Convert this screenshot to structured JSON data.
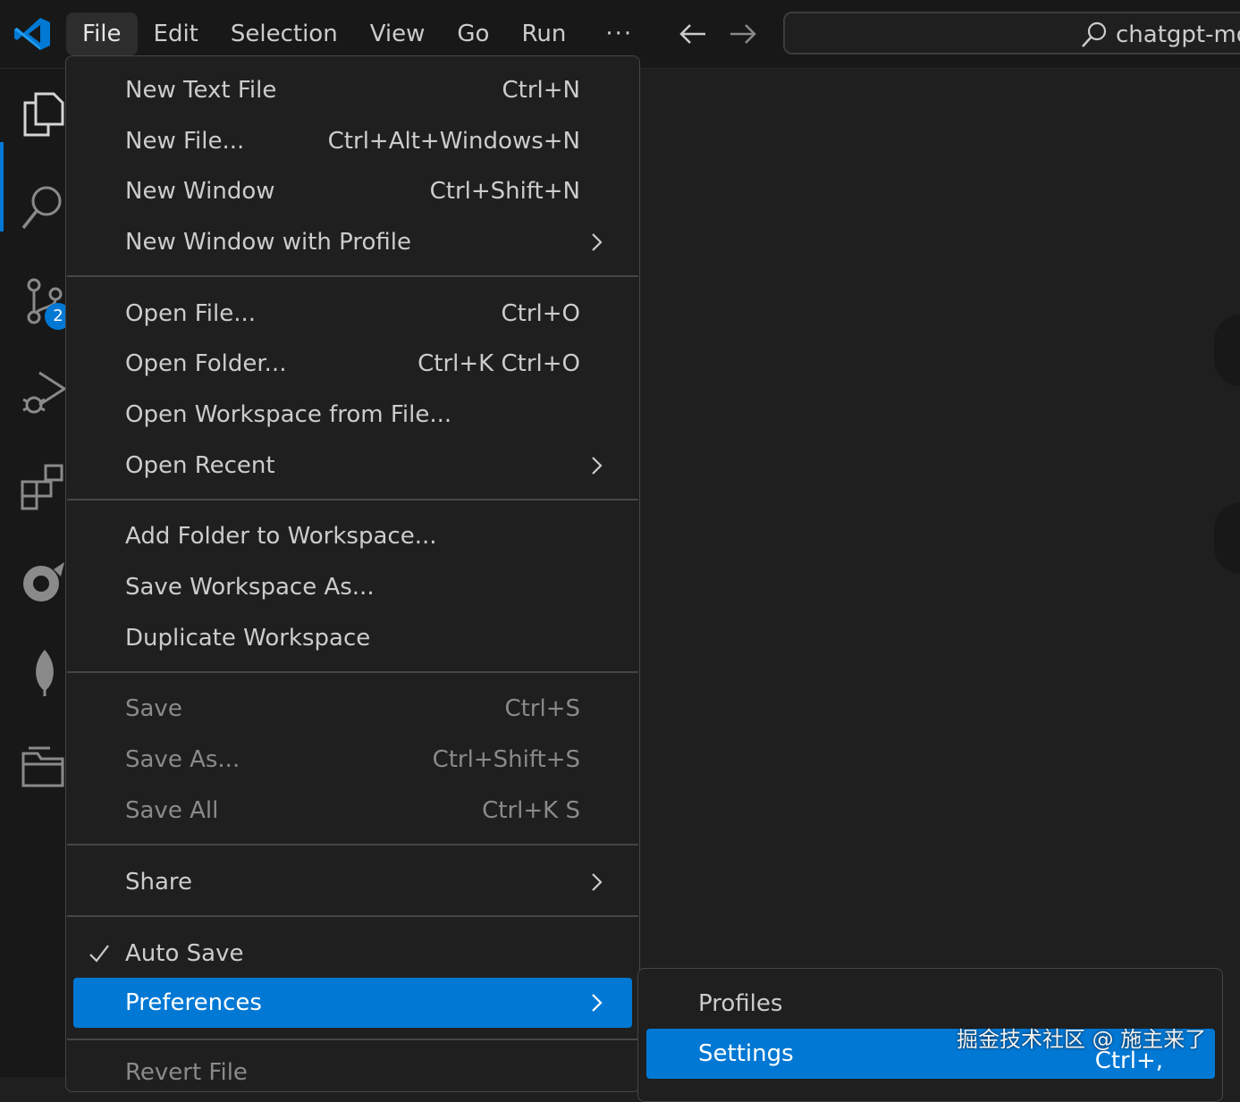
{
  "menubar": {
    "items": [
      "File",
      "Edit",
      "Selection",
      "View",
      "Go",
      "Run"
    ],
    "more": "···"
  },
  "command_center": {
    "text": "chatgpt-mon"
  },
  "activitybar": {
    "source_control_badge": "2"
  },
  "file_menu": {
    "new_text_file": {
      "label": "New Text File",
      "keybinding": "Ctrl+N"
    },
    "new_file": {
      "label": "New File...",
      "keybinding": "Ctrl+Alt+Windows+N"
    },
    "new_window": {
      "label": "New Window",
      "keybinding": "Ctrl+Shift+N"
    },
    "new_window_profile": {
      "label": "New Window with Profile"
    },
    "open_file": {
      "label": "Open File...",
      "keybinding": "Ctrl+O"
    },
    "open_folder": {
      "label": "Open Folder...",
      "keybinding": "Ctrl+K Ctrl+O"
    },
    "open_workspace": {
      "label": "Open Workspace from File..."
    },
    "open_recent": {
      "label": "Open Recent"
    },
    "add_folder": {
      "label": "Add Folder to Workspace..."
    },
    "save_workspace_as": {
      "label": "Save Workspace As..."
    },
    "duplicate_workspace": {
      "label": "Duplicate Workspace"
    },
    "save": {
      "label": "Save",
      "keybinding": "Ctrl+S"
    },
    "save_as": {
      "label": "Save As...",
      "keybinding": "Ctrl+Shift+S"
    },
    "save_all": {
      "label": "Save All",
      "keybinding": "Ctrl+K S"
    },
    "share": {
      "label": "Share"
    },
    "auto_save": {
      "label": "Auto Save",
      "checked": true
    },
    "preferences": {
      "label": "Preferences"
    },
    "revert_file": {
      "label": "Revert File"
    }
  },
  "preferences_submenu": {
    "profiles": {
      "label": "Profiles"
    },
    "settings": {
      "label": "Settings",
      "keybinding": "Ctrl+,"
    }
  },
  "watermark": "掘金技术社区 @ 施主来了",
  "colors": {
    "accent": "#0078d4",
    "background": "#1f1f1f",
    "chrome": "#181818"
  }
}
